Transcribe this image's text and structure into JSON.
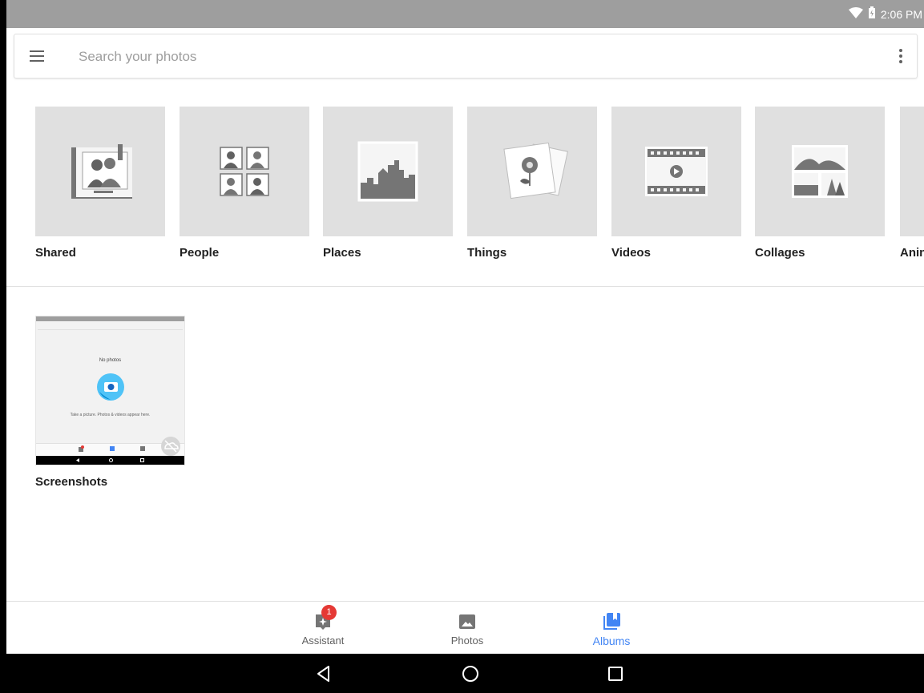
{
  "status_bar": {
    "time": "2:06 PM",
    "icons": [
      "wifi-icon",
      "battery-icon"
    ]
  },
  "search": {
    "placeholder": "Search your photos",
    "value": ""
  },
  "categories": [
    {
      "label": "Shared",
      "icon": "shared-album-icon"
    },
    {
      "label": "People",
      "icon": "people-icon"
    },
    {
      "label": "Places",
      "icon": "places-icon"
    },
    {
      "label": "Things",
      "icon": "things-icon"
    },
    {
      "label": "Videos",
      "icon": "videos-icon"
    },
    {
      "label": "Collages",
      "icon": "collages-icon"
    },
    {
      "label": "Anin",
      "icon": "animations-icon"
    }
  ],
  "albums": [
    {
      "title": "Screenshots",
      "thumbnail": {
        "title": "No photos",
        "text": "Take a picture. Photos & videos appear here."
      }
    }
  ],
  "bottom_nav": {
    "items": [
      {
        "label": "Assistant",
        "icon": "assistant-icon",
        "badge": "1",
        "active": false
      },
      {
        "label": "Photos",
        "icon": "photos-icon",
        "active": false
      },
      {
        "label": "Albums",
        "icon": "albums-icon",
        "active": true
      }
    ]
  },
  "system_nav": {
    "buttons": [
      "back-icon",
      "home-icon",
      "recents-icon"
    ]
  },
  "colors": {
    "accent": "#4285f4",
    "badge": "#e53935",
    "status_bar": "#9e9e9e",
    "tile_bg": "#e0e0e0"
  }
}
